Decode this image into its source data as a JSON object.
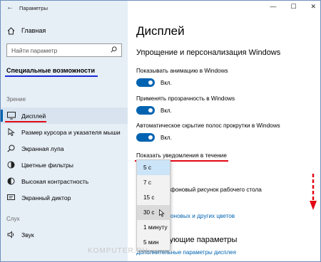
{
  "window": {
    "title": "Параметры"
  },
  "sidebar": {
    "home_label": "Главная",
    "search_placeholder": "Найти параметр",
    "section_title": "Специальные возможности",
    "group_vision": "Зрение",
    "items": [
      {
        "label": "Дисплей",
        "icon": "monitor-icon"
      },
      {
        "label": "Размер курсора и указателя мыши",
        "icon": "cursor-icon"
      },
      {
        "label": "Экранная лупа",
        "icon": "magnifier-icon"
      },
      {
        "label": "Цветные фильтры",
        "icon": "color-filter-icon"
      },
      {
        "label": "Высокая контрастность",
        "icon": "contrast-icon"
      },
      {
        "label": "Экранный диктор",
        "icon": "narrator-icon"
      }
    ],
    "group_hearing": "Слух",
    "hearing_items": [
      {
        "label": "Звук",
        "icon": "speaker-icon"
      }
    ]
  },
  "main": {
    "title": "Дисплей",
    "section_title": "Упрощение и персонализация Windows",
    "settings": [
      {
        "label": "Показывать анимацию в Windows",
        "state": "Вкл."
      },
      {
        "label": "Применять прозрачность в Windows",
        "state": "Вкл."
      },
      {
        "label": "Автоматическое скрытие полос прокрутки в Windows",
        "state": "Вкл."
      }
    ],
    "notification_label": "Показать уведомления в течение",
    "dropdown_options": [
      "5 с",
      "7 с",
      "15 с",
      "30 с",
      "1 минуту",
      "5 мин"
    ],
    "background_text": "фоновый рисунок рабочего стола",
    "colors_link": "оновых и других цветов",
    "related_title": "Сопутствующие параметры",
    "related_link": "Дополнительные параметры дисплея"
  },
  "watermark": "KOMPUTER.RU",
  "colors": {
    "accent": "#0063b1",
    "highlight_red": "#e30613",
    "highlight_blue": "#1a2bd6",
    "sidebar_bg": "#e6eef6"
  }
}
